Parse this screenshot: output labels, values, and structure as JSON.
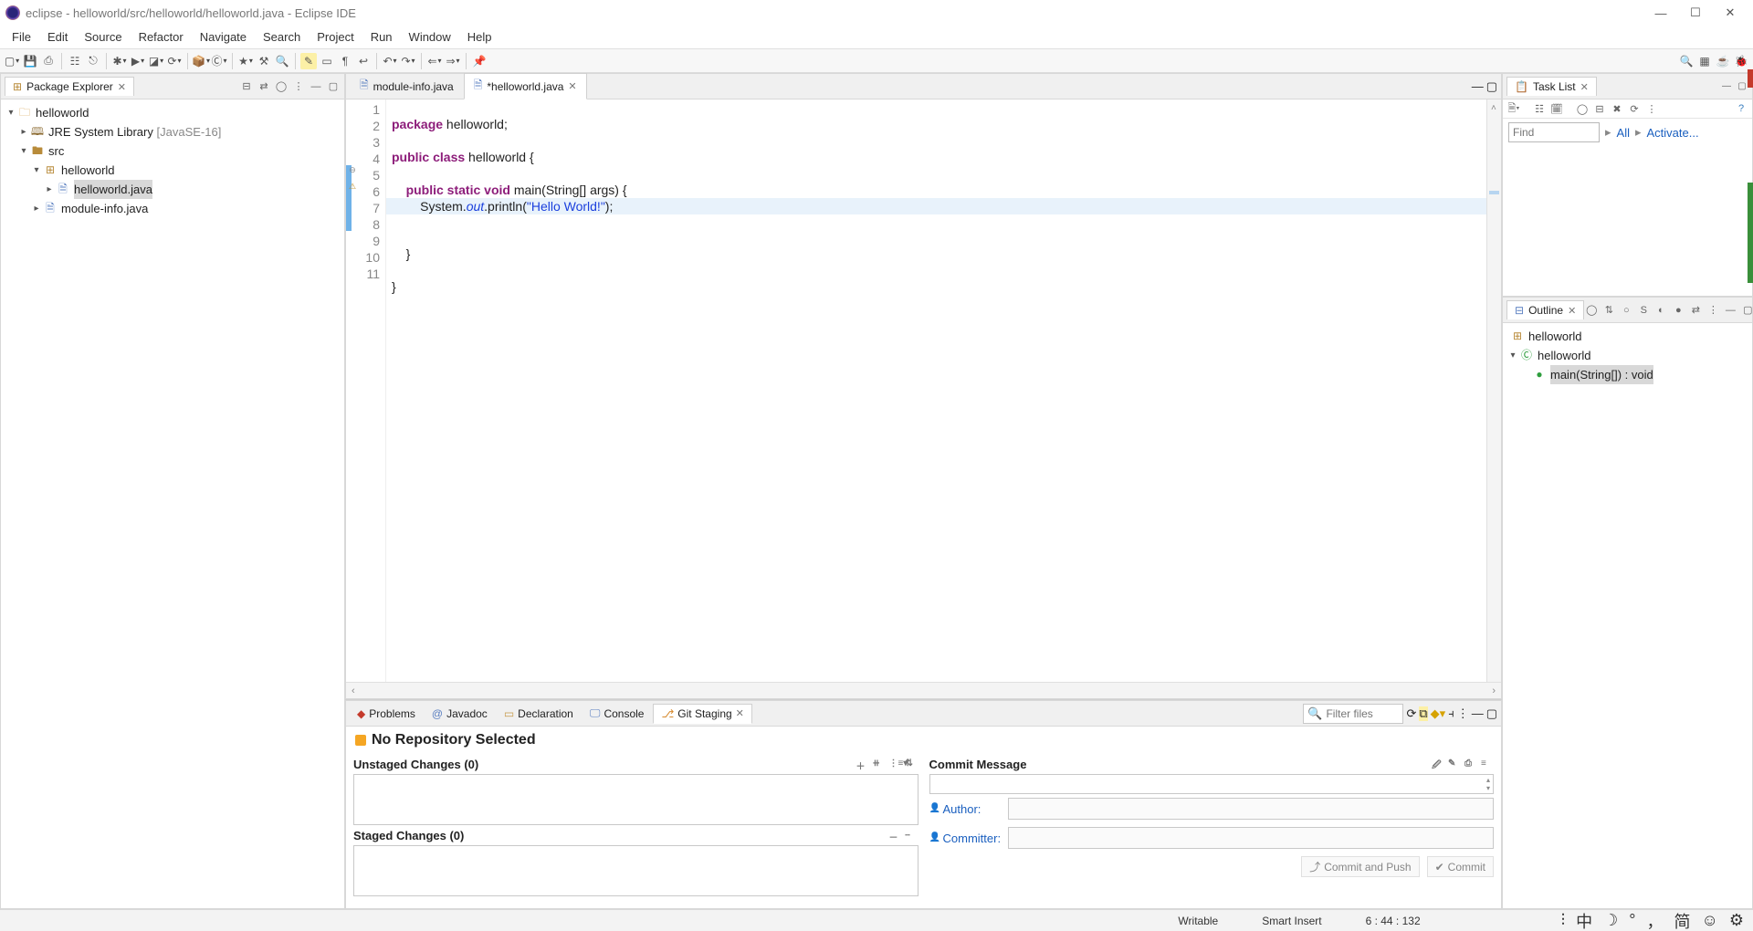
{
  "titlebar": {
    "text": "eclipse - helloworld/src/helloworld/helloworld.java - Eclipse IDE"
  },
  "menubar": {
    "items": [
      "File",
      "Edit",
      "Source",
      "Refactor",
      "Navigate",
      "Search",
      "Project",
      "Run",
      "Window",
      "Help"
    ]
  },
  "pkg_explorer": {
    "title": "Package Explorer",
    "tree": {
      "project": "helloworld",
      "jre": {
        "label": "JRE System Library",
        "extra": "[JavaSE-16]"
      },
      "src": "src",
      "pkg": "helloworld",
      "file1": "helloworld.java",
      "file2": "module-info.java"
    }
  },
  "editor": {
    "tabs": [
      {
        "label": "module-info.java",
        "dirty": false,
        "active": false
      },
      {
        "label": "*helloworld.java",
        "dirty": true,
        "active": true
      }
    ],
    "lines": {
      "l1a": "package",
      "l1b": " helloworld;",
      "l3a": "public",
      "l3b": " class",
      "l3c": " helloworld {",
      "l5a": "public",
      "l5b": " static",
      "l5c": " void",
      "l5d": " main(String[] args) {",
      "l6a": "System.",
      "l6b": "out",
      "l6c": ".println(",
      "l6d": "\"Hello World!\"",
      "l6e": ");",
      "l8": "}",
      "l10": "}"
    },
    "line_numbers": [
      "1",
      "2",
      "3",
      "4",
      "5",
      "6",
      "7",
      "8",
      "9",
      "10",
      "11"
    ]
  },
  "tasklist": {
    "title": "Task List",
    "find_placeholder": "Find",
    "all": "All",
    "activate": "Activate..."
  },
  "outline": {
    "title": "Outline",
    "pkg": "helloworld",
    "class": "helloworld",
    "method": "main(String[]) : void"
  },
  "bottom": {
    "tabs": [
      "Problems",
      "Javadoc",
      "Declaration",
      "Console",
      "Git Staging"
    ],
    "filter_placeholder": "Filter files",
    "repo_title": "No Repository Selected",
    "unstaged": "Unstaged Changes (0)",
    "staged": "Staged Changes (0)",
    "commit_msg": "Commit Message",
    "author": "Author:",
    "committer": "Committer:",
    "btn_push": "Commit and Push",
    "btn_commit": "Commit"
  },
  "statusbar": {
    "writable": "Writable",
    "insert": "Smart Insert",
    "pos": "6 : 44 : 132"
  },
  "ime": {
    "glyph_zhong": "中",
    "glyph_jian": "简",
    "glyph_comma": "，"
  }
}
